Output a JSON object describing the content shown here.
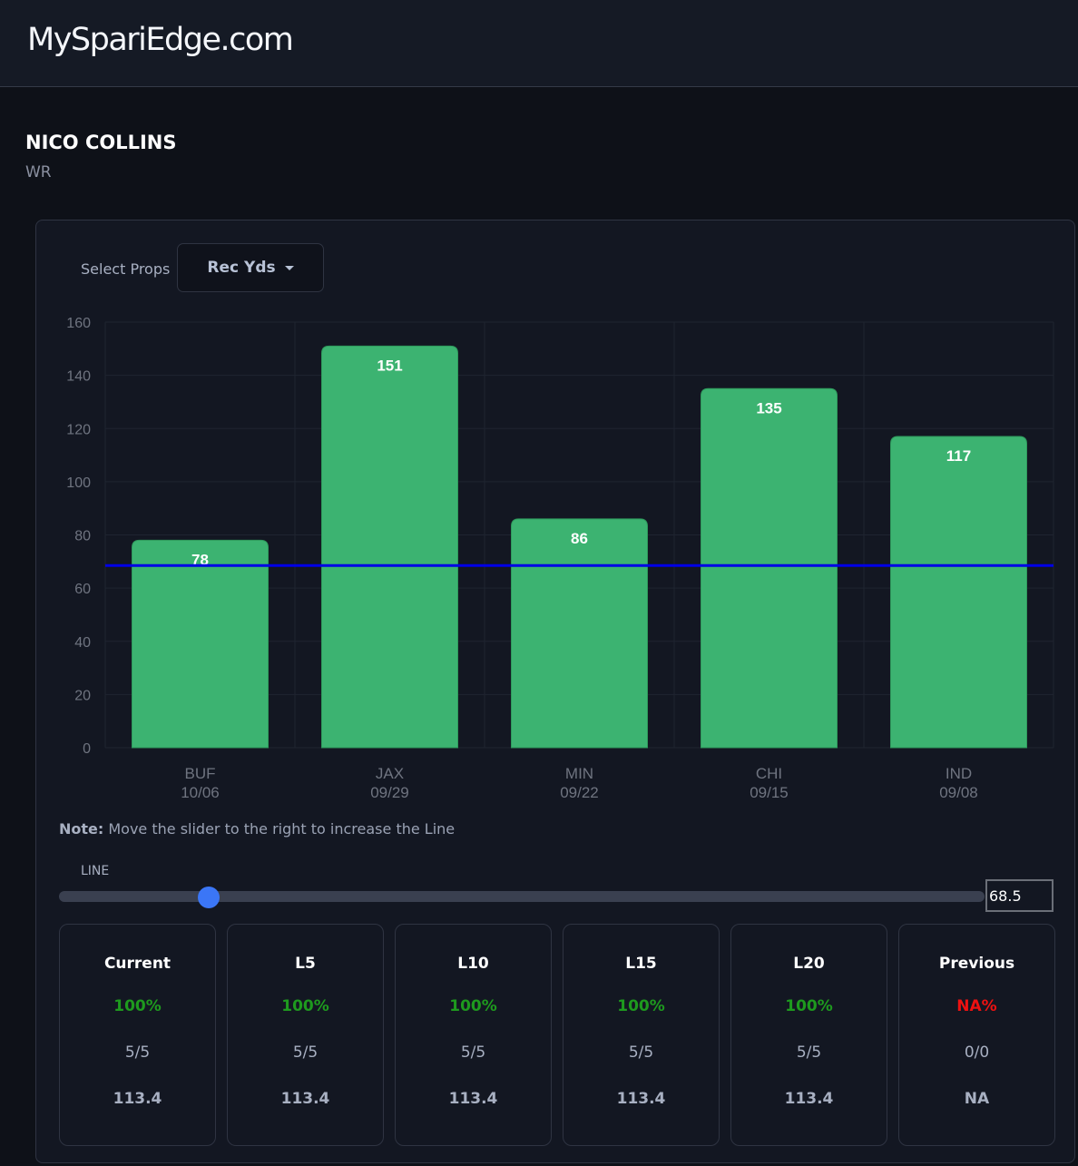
{
  "site": {
    "title": "MySpariEdge.com"
  },
  "player": {
    "name": "NICO COLLINS",
    "position": "WR"
  },
  "props": {
    "label": "Select Props",
    "selected": "Rec Yds"
  },
  "note": {
    "bold": "Note:",
    "text": " Move the slider to the right to increase the Line"
  },
  "slider": {
    "label": "LINE",
    "value": "68.5"
  },
  "colors": {
    "bar": "#3cb371",
    "line": "#0000e6",
    "good": "#1e9a1e",
    "bad": "#ee1111",
    "thumb": "#3b76f6"
  },
  "chart_data": {
    "type": "bar",
    "categories": [
      "BUF",
      "JAX",
      "MIN",
      "CHI",
      "IND"
    ],
    "dates": [
      "10/06",
      "09/29",
      "09/22",
      "09/15",
      "09/08"
    ],
    "values": [
      78,
      151,
      86,
      135,
      117
    ],
    "reference_line": 68.5,
    "ylim": [
      0,
      160
    ],
    "yticks": [
      0,
      20,
      40,
      60,
      80,
      100,
      120,
      140,
      160
    ],
    "grid": true
  },
  "stats": [
    {
      "title": "Current",
      "pct": "100%",
      "record": "5/5",
      "avg": "113.4",
      "status": "good"
    },
    {
      "title": "L5",
      "pct": "100%",
      "record": "5/5",
      "avg": "113.4",
      "status": "good"
    },
    {
      "title": "L10",
      "pct": "100%",
      "record": "5/5",
      "avg": "113.4",
      "status": "good"
    },
    {
      "title": "L15",
      "pct": "100%",
      "record": "5/5",
      "avg": "113.4",
      "status": "good"
    },
    {
      "title": "L20",
      "pct": "100%",
      "record": "5/5",
      "avg": "113.4",
      "status": "good"
    },
    {
      "title": "Previous",
      "pct": "NA%",
      "record": "0/0",
      "avg": "NA",
      "status": "bad"
    }
  ]
}
